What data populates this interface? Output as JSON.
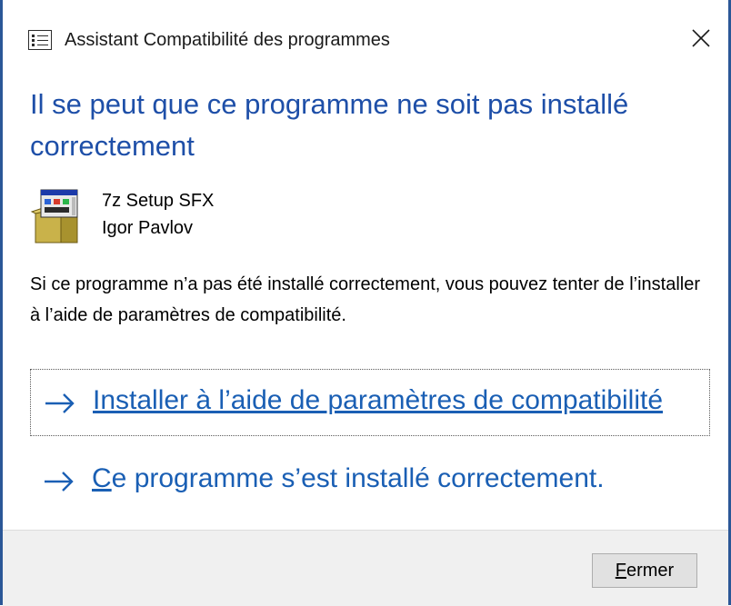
{
  "window": {
    "title": "Assistant Compatibilité des programmes",
    "close_icon": "close-icon"
  },
  "heading": "Il se peut que ce programme ne soit pas installé correctement",
  "program": {
    "name": "7z Setup SFX",
    "publisher": "Igor Pavlov",
    "icon": "installer-box-icon"
  },
  "description": "Si ce programme n’a pas été installé correctement, vous pouvez tenter de l’installer à l’aide de paramètres de compatibilité.",
  "options": [
    {
      "label": "Installer à l’aide de paramètres de compatibilité",
      "icon": "arrow-right-icon",
      "focused": true
    },
    {
      "label_mnemonic": "C",
      "label_rest": "e programme s’est installé correctement.",
      "icon": "arrow-right-icon",
      "focused": false
    }
  ],
  "footer": {
    "close_mnemonic": "F",
    "close_rest": "ermer"
  },
  "colors": {
    "heading": "#1e4fa8",
    "link": "#1a5fb4",
    "border": "#2b5797",
    "footer_bg": "#f0f0f0"
  }
}
